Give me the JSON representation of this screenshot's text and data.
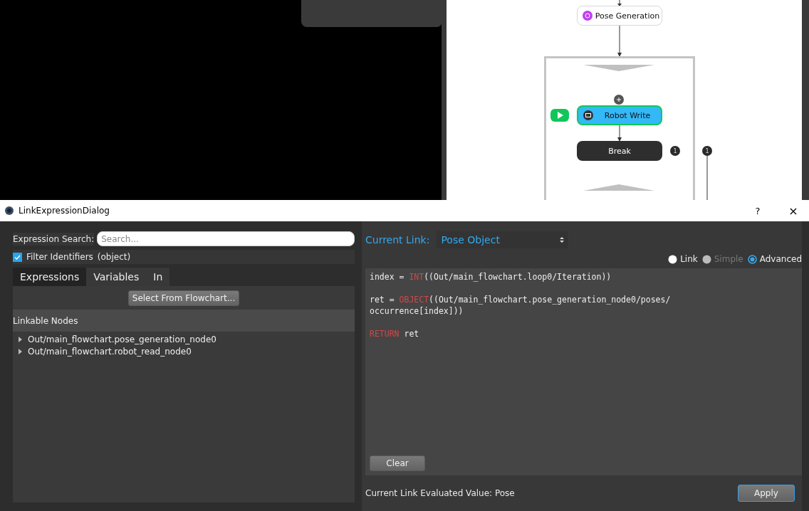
{
  "flowchart": {
    "nodes": [
      {
        "kind": "pose",
        "label": "Pose Generation",
        "active": false
      },
      {
        "kind": "robot",
        "label": "Robot Write",
        "active": true
      },
      {
        "kind": "break",
        "label": "Break",
        "active": false
      }
    ],
    "badges": [
      {
        "text": "1"
      },
      {
        "text": "1"
      }
    ]
  },
  "dialog": {
    "title": "LinkExpressionDialog",
    "help": "?",
    "close": "×",
    "search": {
      "label": "Expression Search:",
      "placeholder": "Search..."
    },
    "filter": {
      "label": "Filter Identifiers",
      "checked": true,
      "type": "(object)"
    },
    "tabs": [
      {
        "label": "Expressions",
        "selected": true
      },
      {
        "label": "Variables",
        "selected": false
      },
      {
        "label": "In",
        "selected": false
      }
    ],
    "select_button": "Select From Flowchart...",
    "tree": {
      "header": "Linkable Nodes",
      "items": [
        {
          "label": "Out/main_flowchart.pose_generation_node0",
          "expanded": false
        },
        {
          "label": "Out/main_flowchart.robot_read_node0",
          "expanded": false
        }
      ]
    },
    "current_link": {
      "label": "Current Link:",
      "value": "Pose Object"
    },
    "modes": [
      {
        "label": "Link",
        "selected": false,
        "disabled": false
      },
      {
        "label": "Simple",
        "selected": false,
        "disabled": true
      },
      {
        "label": "Advanced",
        "selected": true,
        "disabled": false
      }
    ],
    "code": [
      [
        [
          {
            "text": "index = ",
            "kind": "plain"
          },
          {
            "text": "INT",
            "kind": "keyword"
          },
          {
            "text": "((Out/main_flowchart.loop0/Iteration))",
            "kind": "plain"
          }
        ]
      ],
      [
        [
          {
            "text": "ret = ",
            "kind": "plain"
          },
          {
            "text": "OBJECT",
            "kind": "keyword"
          },
          {
            "text": "((Out/main_flowchart.pose_generation_node0/poses/",
            "kind": "plain"
          }
        ],
        [
          {
            "text": "occurrence[index]))",
            "kind": "plain"
          }
        ]
      ],
      [
        [
          {
            "text": "RETURN",
            "kind": "keyword"
          },
          {
            "text": " ret",
            "kind": "plain"
          }
        ]
      ]
    ],
    "clear_button": "Clear",
    "evaluated": "Current Link Evaluated Value: Pose",
    "apply_button": "Apply"
  }
}
